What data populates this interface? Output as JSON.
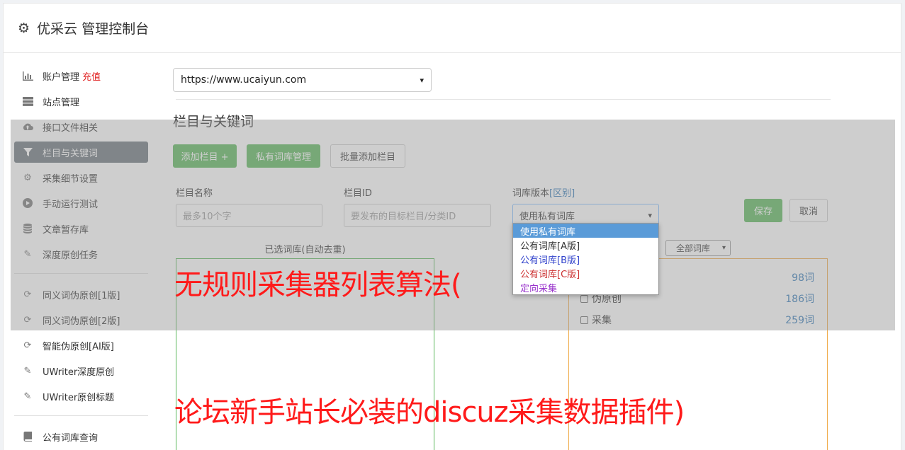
{
  "header": {
    "title": "优采云 管理控制台"
  },
  "sidebar": {
    "items": [
      {
        "icon": "bar-chart-icon",
        "label": "账户管理",
        "extra": "充值"
      },
      {
        "icon": "server-icon",
        "label": "站点管理"
      },
      {
        "icon": "cloud-upload-icon",
        "label": "接口文件相关"
      },
      {
        "icon": "filter-icon",
        "label": "栏目与关键词",
        "active": true
      },
      {
        "icon": "cogs-icon",
        "label": "采集细节设置"
      },
      {
        "icon": "play-circle-icon",
        "label": "手动运行测试"
      },
      {
        "icon": "database-icon",
        "label": "文章暂存库"
      },
      {
        "icon": "edit-icon",
        "label": "深度原创任务"
      }
    ],
    "items2": [
      {
        "icon": "refresh-icon",
        "label": "同义词伪原创[1版]"
      },
      {
        "icon": "refresh-icon",
        "label": "同义词伪原创[2版]"
      },
      {
        "icon": "refresh-icon",
        "label": "智能伪原创[AI版]"
      },
      {
        "icon": "edit-icon",
        "label": "UWriter深度原创"
      },
      {
        "icon": "edit-icon",
        "label": "UWriter原创标题"
      }
    ],
    "items3": [
      {
        "icon": "book-icon",
        "label": "公有词库查询"
      }
    ]
  },
  "main": {
    "site_url": "https://www.ucaiyun.com",
    "section_title": "栏目与关键词",
    "buttons": {
      "add_column": "添加栏目 +",
      "private_lib": "私有词库管理",
      "batch_add": "批量添加栏目",
      "save": "保存",
      "cancel": "取消"
    },
    "form": {
      "name_label": "栏目名称",
      "name_placeholder": "最多10个字",
      "id_label": "栏目ID",
      "id_placeholder": "要发布的目标栏目/分类ID",
      "version_label": "词库版本",
      "version_link": "[区别]",
      "version_value": "使用私有词库"
    },
    "version_options": [
      {
        "label": "使用私有词库",
        "color": "#ffffff",
        "selected": true
      },
      {
        "label": "公有词库[A版]",
        "color": "#333333"
      },
      {
        "label": "公有词库[B版]",
        "color": "#3344cc"
      },
      {
        "label": "公有词库[C版]",
        "color": "#cc3333"
      },
      {
        "label": "定向采集",
        "color": "#9933cc"
      }
    ],
    "selected_lib_title": "已选词库(自动去重)",
    "filter_value": "全部词库",
    "libraries": [
      {
        "name": "",
        "count": "98词"
      },
      {
        "name": "伪原创",
        "count": "186词"
      },
      {
        "name": "采集",
        "count": "259词"
      }
    ]
  },
  "captions": {
    "line1": "无规则采集器列表算法(",
    "line2": "论坛新手站长必装的discuz采集数据插件)"
  }
}
